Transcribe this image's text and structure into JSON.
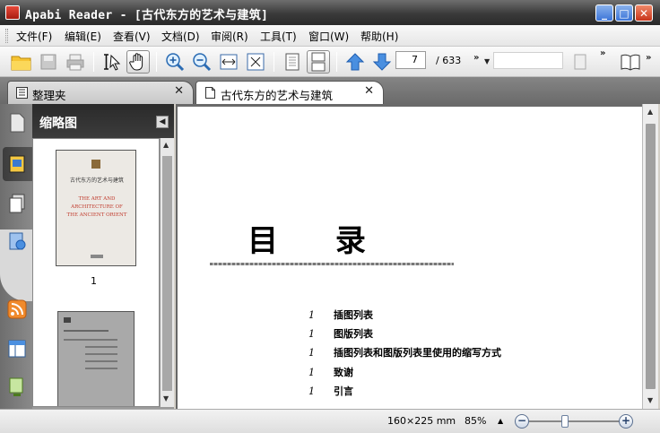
{
  "window": {
    "title": "Apabi Reader - [古代东方的艺术与建筑]",
    "minimize_glyph": "_",
    "maximize_glyph": "□",
    "close_glyph": "✕"
  },
  "menu": {
    "items": [
      "文件(F)",
      "编辑(E)",
      "查看(V)",
      "文档(D)",
      "审阅(R)",
      "工具(T)",
      "窗口(W)",
      "帮助(H)"
    ]
  },
  "toolbar": {
    "buttons": [
      "open-folder",
      "save",
      "print",
      "select-text",
      "hand-tool",
      "zoom-in",
      "zoom-out",
      "fit-width",
      "fit-page",
      "single-page",
      "continuous-page",
      "prev-page",
      "next-page"
    ],
    "current_page": "7",
    "total_pages": "/ 633",
    "search_value": "",
    "overflow_glyph": "»"
  },
  "tabs": [
    {
      "label": "整理夹",
      "icon": "bookshelf-icon",
      "active": false,
      "close_glyph": "✕"
    },
    {
      "label": "古代东方的艺术与建筑",
      "icon": "document-icon",
      "active": true,
      "close_glyph": "✕"
    }
  ],
  "sidebar": {
    "title": "缩略图",
    "collapse_glyph": "◀",
    "rail_icons": [
      "page-icon",
      "thumbnail-icon",
      "layers-icon",
      "media-icon",
      "rss-icon",
      "layout-icon",
      "export-icon"
    ],
    "thumbnails": [
      {
        "page_label": "1",
        "cover_text": "古代东方的艺术与建筑",
        "cover_english": "THE ART AND ARCHITECTURE OF THE ANCIENT ORIENT"
      },
      {
        "page_label": ""
      }
    ]
  },
  "document": {
    "heading": "目 录",
    "toc": [
      {
        "num": "1",
        "text": "插图列表"
      },
      {
        "num": "1",
        "text": "图版列表"
      },
      {
        "num": "1",
        "text": "插图列表和图版列表里使用的缩写方式"
      },
      {
        "num": "1",
        "text": "致谢"
      },
      {
        "num": "1",
        "text": "引言"
      }
    ]
  },
  "status": {
    "page_size": "160×225 mm",
    "zoom": "85%",
    "zoom_minus": "−",
    "zoom_plus": "+",
    "zoom_level": 0.4
  }
}
